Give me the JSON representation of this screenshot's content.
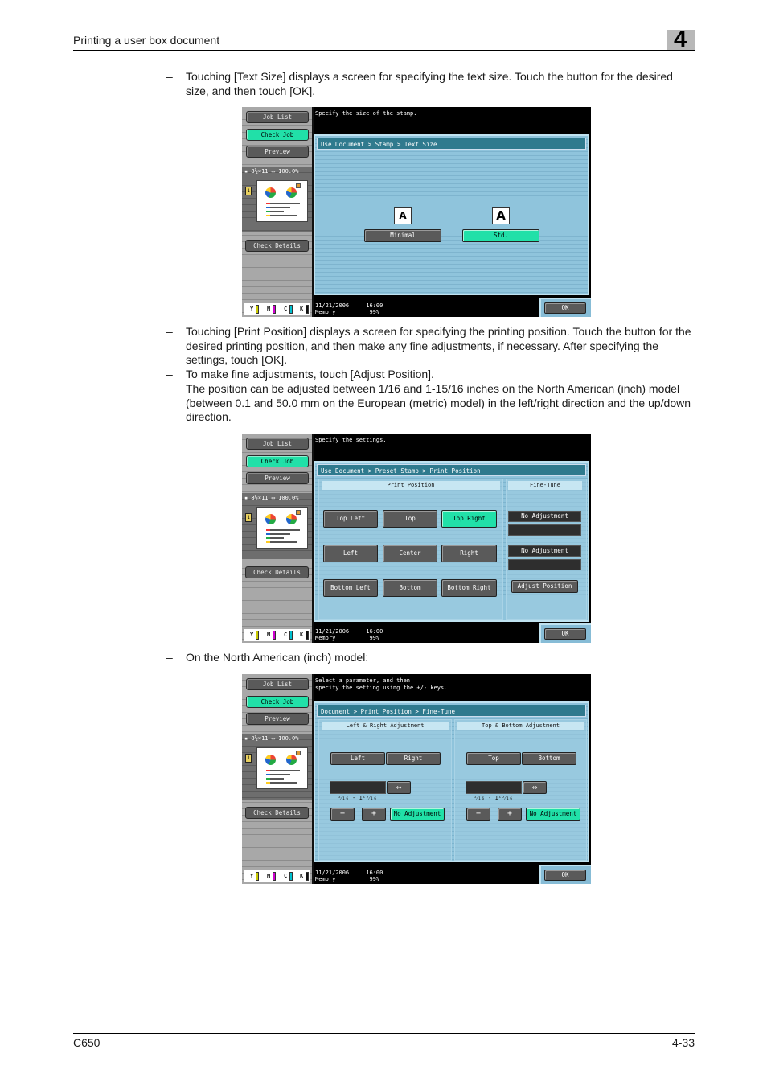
{
  "header": {
    "title": "Printing a user box document",
    "chapter": "4"
  },
  "footer": {
    "model": "C650",
    "page": "4-33"
  },
  "bullets": {
    "dash": "–",
    "b1": "Touching [Text Size] displays a screen for specifying the text size. Touch the button for the desired size, and then touch [OK].",
    "b2": "Touching [Print Position] displays a screen for specifying the printing position. Touch the button for the desired printing position, and then make any fine adjustments, if necessary. After specifying the settings, touch [OK].",
    "b3": "To make fine adjustments, touch [Adjust Position].",
    "b3_detail": "The position can be adjusted between 1/16 and 1-15/16 inches on the North American (inch) model (between 0.1 and 50.0 mm on the European (metric) model) in the left/right direction and the up/down direction.",
    "b4": "On the North American (inch) model:"
  },
  "sidebar": {
    "job_list": "Job List",
    "check_job": "Check Job",
    "preview": "Preview",
    "thumb_info": "▪ 8½×11 ▭  100.0%",
    "page_icon": "1",
    "check_details": "Check Details",
    "toner": [
      "Y",
      "M",
      "C",
      "K"
    ],
    "toner_colors": [
      "#c8c800",
      "#d000d0",
      "#00c0d0",
      "#111111"
    ]
  },
  "status": {
    "date": "11/21/2006",
    "time": "16:00",
    "memory_label": "Memory",
    "memory": "99%"
  },
  "ok_label": "OK",
  "screen1": {
    "message": "Specify the size of the stamp.",
    "breadcrumb": "Use Document > Stamp > Text Size",
    "icon_glyph": "A",
    "buttons": [
      {
        "label": "Minimal",
        "selected": false
      },
      {
        "label": "Std.",
        "selected": true
      }
    ]
  },
  "screen2": {
    "message": "Specify the settings.",
    "breadcrumb": "Use Document > Preset Stamp > Print Position",
    "print_position_header": "Print Position",
    "fine_tune_header": "Fine-Tune",
    "positions": [
      {
        "label": "Top Left",
        "selected": false
      },
      {
        "label": "Top",
        "selected": false
      },
      {
        "label": "Top Right",
        "selected": true
      },
      {
        "label": "Left",
        "selected": false
      },
      {
        "label": "Center",
        "selected": false
      },
      {
        "label": "Right",
        "selected": false
      },
      {
        "label": "Bottom Left",
        "selected": false
      },
      {
        "label": "Bottom",
        "selected": false
      },
      {
        "label": "Bottom Right",
        "selected": false
      }
    ],
    "fine_tune_1": "No Adjustment",
    "fine_tune_2": "No Adjustment",
    "adjust_position": "Adjust Position"
  },
  "screen3": {
    "message": "Select a parameter, and then\nspecify the setting using the +/- keys.",
    "breadcrumb": "Document > Print Position > Fine-Tune",
    "lr_header": "Left & Right Adjustment",
    "tb_header": "Top & Bottom Adjustment",
    "lr_buttons": [
      "Left",
      "Right"
    ],
    "tb_buttons": [
      "Top",
      "Bottom"
    ],
    "swap_icon": "⇔",
    "range": "¹⁄₁₆   -   1¹⁵⁄₁₆",
    "minus": "−",
    "plus": "+",
    "no_adjustment": "No Adjustment"
  }
}
